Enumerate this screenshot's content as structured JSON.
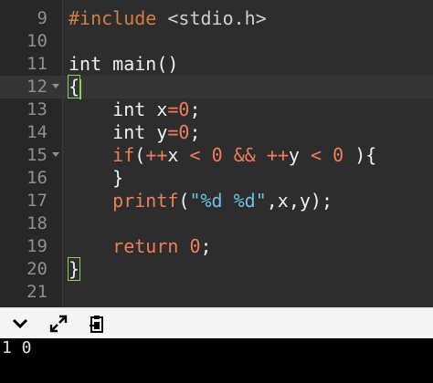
{
  "editor": {
    "lines": [
      {
        "num": "9",
        "fold": false,
        "tokens": [
          {
            "t": "#include ",
            "c": "t-pre"
          },
          {
            "t": "<stdio.h>",
            "c": "t-lib"
          }
        ]
      },
      {
        "num": "10",
        "fold": false,
        "tokens": []
      },
      {
        "num": "11",
        "fold": false,
        "tokens": [
          {
            "t": "int main()",
            "c": "t-plain"
          }
        ]
      },
      {
        "num": "12",
        "fold": true,
        "active": true,
        "tokens": [
          {
            "t": "{",
            "c": "t-plain",
            "hl": true
          }
        ]
      },
      {
        "num": "13",
        "fold": false,
        "tokens": [
          {
            "t": "    int x",
            "c": "t-plain"
          },
          {
            "t": "=",
            "c": "t-op"
          },
          {
            "t": "0",
            "c": "t-num"
          },
          {
            "t": ";",
            "c": "t-plain"
          }
        ]
      },
      {
        "num": "14",
        "fold": false,
        "tokens": [
          {
            "t": "    int y",
            "c": "t-plain"
          },
          {
            "t": "=",
            "c": "t-op"
          },
          {
            "t": "0",
            "c": "t-num"
          },
          {
            "t": ";",
            "c": "t-plain"
          }
        ]
      },
      {
        "num": "15",
        "fold": true,
        "tokens": [
          {
            "t": "    ",
            "c": "t-plain"
          },
          {
            "t": "if",
            "c": "t-kw"
          },
          {
            "t": "(",
            "c": "t-plain"
          },
          {
            "t": "++",
            "c": "t-op"
          },
          {
            "t": "x ",
            "c": "t-plain"
          },
          {
            "t": "<",
            "c": "t-op"
          },
          {
            "t": " ",
            "c": "t-plain"
          },
          {
            "t": "0",
            "c": "t-num"
          },
          {
            "t": " ",
            "c": "t-plain"
          },
          {
            "t": "&&",
            "c": "t-op"
          },
          {
            "t": " ",
            "c": "t-plain"
          },
          {
            "t": "++",
            "c": "t-op"
          },
          {
            "t": "y ",
            "c": "t-plain"
          },
          {
            "t": "<",
            "c": "t-op"
          },
          {
            "t": " ",
            "c": "t-plain"
          },
          {
            "t": "0",
            "c": "t-num"
          },
          {
            "t": " ){",
            "c": "t-plain"
          }
        ]
      },
      {
        "num": "16",
        "fold": false,
        "tokens": [
          {
            "t": "    }",
            "c": "t-plain"
          }
        ]
      },
      {
        "num": "17",
        "fold": false,
        "tokens": [
          {
            "t": "    ",
            "c": "t-plain"
          },
          {
            "t": "printf",
            "c": "t-fn"
          },
          {
            "t": "(",
            "c": "t-plain"
          },
          {
            "t": "\"%d %d\"",
            "c": "t-str"
          },
          {
            "t": ",x,y);",
            "c": "t-plain"
          }
        ]
      },
      {
        "num": "18",
        "fold": false,
        "tokens": []
      },
      {
        "num": "19",
        "fold": false,
        "tokens": [
          {
            "t": "    ",
            "c": "t-plain"
          },
          {
            "t": "return",
            "c": "t-kw"
          },
          {
            "t": " ",
            "c": "t-plain"
          },
          {
            "t": "0",
            "c": "t-num"
          },
          {
            "t": ";",
            "c": "t-plain"
          }
        ]
      },
      {
        "num": "20",
        "fold": false,
        "tokens": [
          {
            "t": "}",
            "c": "t-plain",
            "hl": true
          }
        ]
      },
      {
        "num": "21",
        "fold": false,
        "tokens": []
      }
    ]
  },
  "toolbar": {
    "buttons": [
      {
        "name": "chevron-down-icon"
      },
      {
        "name": "expand-icon"
      },
      {
        "name": "clipboard-icon"
      }
    ]
  },
  "console": {
    "output": "1 0"
  }
}
